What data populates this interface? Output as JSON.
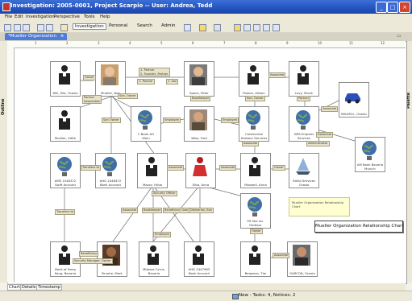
{
  "window": {
    "title": "Investigation: 2005-0001, Project Scarpio -- User: Andrea, Tedd"
  },
  "menu": [
    "File",
    "Edit",
    "Investigation",
    "Perspective",
    "Tools",
    "Help"
  ],
  "toolbar": {
    "perspectives": [
      "Investigation",
      "Personal",
      "Search",
      "Admin"
    ],
    "active": "Investigation"
  },
  "editor_tab": {
    "label": "*Mueller Organization"
  },
  "side_panels": {
    "outline": "Outline",
    "palette": "Palette"
  },
  "ruler": {
    "marks": [
      "1",
      "2",
      "3",
      "4",
      "5",
      "6",
      "7",
      "8",
      "9",
      "10",
      "11",
      "12"
    ]
  },
  "nodes": [
    {
      "id": "n1",
      "caption": "Will, Ella, Ocasio",
      "kind": "person"
    },
    {
      "id": "n2",
      "caption": "Mueller, Ben",
      "kind": "photo"
    },
    {
      "id": "n3",
      "caption": "Spock, Peter",
      "kind": "photo"
    },
    {
      "id": "n4",
      "caption": "Potack, Allison",
      "kind": "person"
    },
    {
      "id": "n5",
      "caption": "Levy, Brock",
      "kind": "person"
    },
    {
      "id": "n6",
      "caption": "Mueller, Edith",
      "kind": "person"
    },
    {
      "id": "n7",
      "caption": "C Bank AG\nKlein",
      "kind": "globe"
    },
    {
      "id": "n8",
      "caption": "Wise, Fred",
      "kind": "photo"
    },
    {
      "id": "n9",
      "caption": "Continental\nHarbour Services",
      "kind": "globe"
    },
    {
      "id": "n10",
      "caption": "SMS Empires\nServices",
      "kind": "globe"
    },
    {
      "id": "n11",
      "caption": "BAUMOL, Ocasio",
      "kind": "car"
    },
    {
      "id": "n12",
      "caption": "AM Bank Bavaria\nMunich",
      "kind": "globe"
    },
    {
      "id": "n13",
      "caption": "AMS 1048372\nSwift Account",
      "kind": "globe"
    },
    {
      "id": "n14",
      "caption": "AHG 2448472\nBank Account",
      "kind": "globe"
    },
    {
      "id": "n15",
      "caption": "Mazzy, Hilda",
      "kind": "person"
    },
    {
      "id": "n16",
      "caption": "Elba, Anna",
      "kind": "red"
    },
    {
      "id": "n17",
      "caption": "Maxwell, Anna",
      "kind": "person"
    },
    {
      "id": "n18",
      "caption": "Stella Services\nOcasio",
      "kind": "boat"
    },
    {
      "id": "n19",
      "caption": "SS Sea Inc.\nHarbour",
      "kind": "globe"
    },
    {
      "id": "n20",
      "caption": "Bank of Hong\nKong, Bavaria",
      "kind": "person"
    },
    {
      "id": "n21",
      "caption": "Bruehe, Mark",
      "kind": "photo"
    },
    {
      "id": "n22",
      "caption": "Mitasse Cyrus,\nBavaria",
      "kind": "person"
    },
    {
      "id": "n23",
      "caption": "AHG 2447985\nBank Account",
      "kind": "person"
    },
    {
      "id": "n24",
      "caption": "Bergman, Tim",
      "kind": "person"
    },
    {
      "id": "n25",
      "caption": "GARCON, Ocasio",
      "kind": "photo"
    }
  ],
  "link_labels": [
    "Owner",
    "1. Partner\n2. Founder, Partner",
    "1. Partner",
    "1. Son",
    "Bookkeeper",
    "Associate",
    "Partner\nAssociation",
    "Son, Owner",
    "Son, Owner",
    "Partner",
    "Associate",
    "Son Owner",
    "Employee",
    "Employee",
    "Associate",
    "Transfers to",
    "Associate",
    "Associate",
    "Owner",
    "Associate",
    "Administrator",
    "Security Officer",
    "Associate",
    "Bookkeeper",
    "Beneficiary User",
    "Deliveries, Son",
    "Employee",
    "Owner",
    "Transfers to",
    "Beneficiary",
    "Security Manager, Owner",
    "Associate"
  ],
  "note": {
    "text": "Mueller Organization Relationship Chart"
  },
  "tooltip": {
    "text": "Mueller Organization Relationship Chart"
  },
  "bottom_tabs": [
    "Chart",
    "Details",
    "Timestamp"
  ],
  "status": {
    "text": "New - Tasks: 4, Notices: 2"
  }
}
